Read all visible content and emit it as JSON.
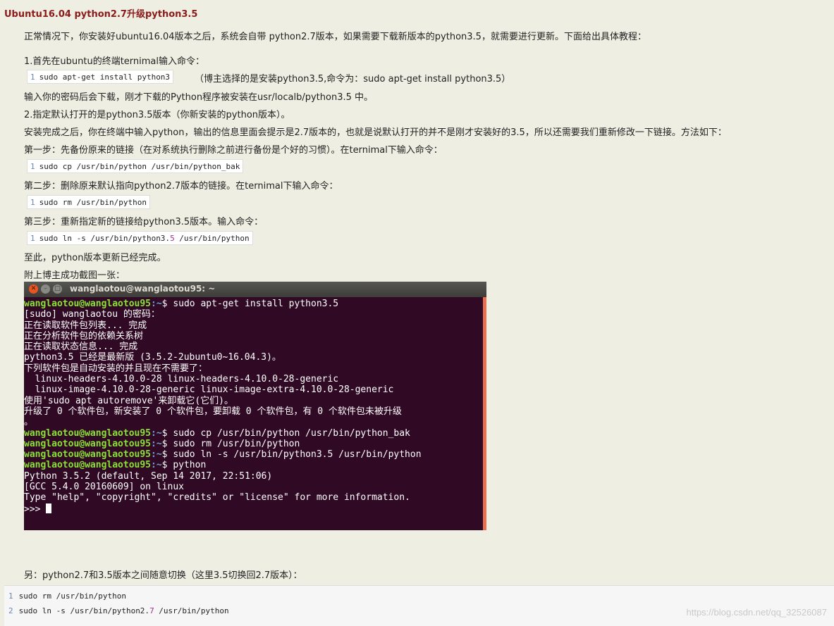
{
  "title": "Ubuntu16.04 python2.7升级python3.5",
  "intro": "正常情况下，你安装好ubuntu16.04版本之后，系统会自带 python2.7版本，如果需要下载新版本的python3.5，就需要进行更新。下面给出具体教程：",
  "step1_heading": "1.首先在ubuntu的终端ternimal输入命令：",
  "cmd_install": {
    "line": "1",
    "code": "sudo apt-get install python3"
  },
  "cmd_install_note": "（博主选择的是安装python3.5,命令为：sudo apt-get install python3.5）",
  "after_install": "输入你的密码后会下载，刚才下载的Python程序被安装在usr/localb/python3.5 中。",
  "step2_heading": "2.指定默认打开的是python3.5版本（你新安装的python版本）。",
  "step2_desc": "安装完成之后，你在终端中输入python，输出的信息里面会提示是2.7版本的，也就是说默认打开的并不是刚才安装好的3.5，所以还需要我们重新修改一下链接。方法如下：",
  "sub1": "第一步：先备份原来的链接（在对系统执行删除之前进行备份是个好的习惯）。在ternimal下输入命令：",
  "cmd_cp": {
    "line": "1",
    "code": "sudo cp /usr/bin/python /usr/bin/python_bak"
  },
  "sub2": "第二步：删除原来默认指向python2.7版本的链接。在ternimal下输入命令：",
  "cmd_rm": {
    "line": "1",
    "code": "sudo rm /usr/bin/python"
  },
  "sub3": "第三步：重新指定新的链接给python3.5版本。输入命令：",
  "cmd_ln": {
    "line": "1",
    "code_a": "sudo ln -s /usr/bin/python3.",
    "code_num": "5",
    "code_b": " /usr/bin/python"
  },
  "done": "至此，python版本更新已经完成。",
  "screenshot_label": "附上博主成功截图一张：",
  "terminal": {
    "window_title": "wanglaotou@wanglaotou95: ~",
    "prompt_user": "wanglaotou@wanglaotou95",
    "prompt_path": ":~",
    "l1": "$ sudo apt-get install python3.5",
    "l2": "[sudo] wanglaotou 的密码：",
    "l3": "正在读取软件包列表... 完成",
    "l4": "正在分析软件包的依赖关系树",
    "l5": "正在读取状态信息... 完成",
    "l6": "python3.5 已经是最新版 (3.5.2-2ubuntu0~16.04.3)。",
    "l7": "下列软件包是自动安装的并且现在不需要了：",
    "l8": "  linux-headers-4.10.0-28 linux-headers-4.10.0-28-generic",
    "l9": "  linux-image-4.10.0-28-generic linux-image-extra-4.10.0-28-generic",
    "l10": "使用'sudo apt autoremove'来卸载它(它们)。",
    "l11": "升级了 0 个软件包，新安装了 0 个软件包，要卸载 0 个软件包，有 0 个软件包未被升级",
    "l12": "。",
    "c1": "$ sudo cp /usr/bin/python /usr/bin/python_bak",
    "c2": "$ sudo rm /usr/bin/python",
    "c3": "$ sudo ln -s /usr/bin/python3.5 /usr/bin/python",
    "c4": "$ python",
    "o1": "Python 3.5.2 (default, Sep 14 2017, 22:51:06)",
    "o2": "[GCC 5.4.0 20160609] on linux",
    "o3": "Type \"help\", \"copyright\", \"credits\" or \"license\" for more information.",
    "o4": ">>> "
  },
  "switch_note": "另：python2.7和3.5版本之间随意切换（这里3.5切换回2.7版本）：",
  "bottom_code": {
    "r1_line": "1",
    "r1_code": "sudo rm /usr/bin/python",
    "r2_line": "2",
    "r2_code_a": "sudo ln -s /usr/bin/python2.",
    "r2_num": "7",
    "r2_code_b": " /usr/bin/python"
  },
  "watermark": "https://blog.csdn.net/qq_32526087"
}
